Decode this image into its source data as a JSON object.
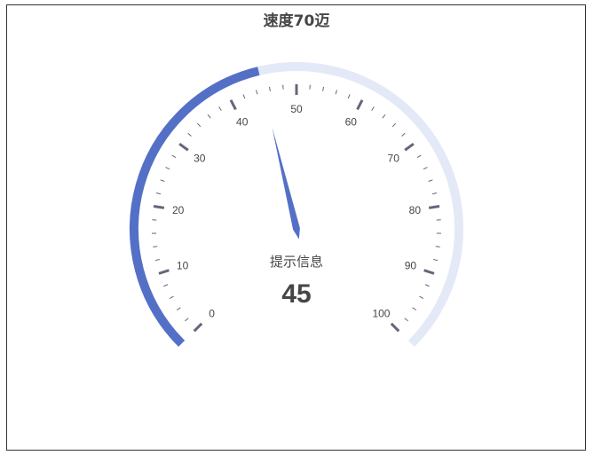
{
  "chart_data": {
    "type": "gauge",
    "title": "速度70迈",
    "min": 0,
    "max": 100,
    "value": 45,
    "detail_name": "提示信息",
    "detail_value": "45",
    "tick_labels": [
      "0",
      "10",
      "20",
      "30",
      "40",
      "50",
      "60",
      "70",
      "80",
      "90",
      "100"
    ],
    "colors": {
      "progress": "#5470c6",
      "track": "#e3e9f6",
      "pointer": "#5470c6",
      "ticks": "#63677a",
      "text": "#464646"
    }
  }
}
